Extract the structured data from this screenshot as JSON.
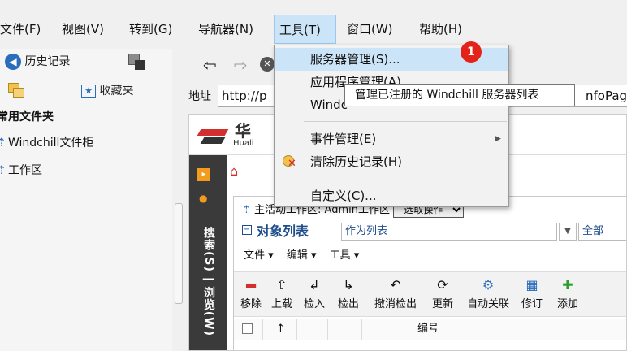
{
  "menubar": {
    "items": [
      "文件(F)",
      "视图(V)",
      "转到(G)",
      "导航器(N)",
      "工具(T)",
      "窗口(W)",
      "帮助(H)"
    ]
  },
  "left_pane": {
    "history_label": "历史记录",
    "favorites_label": "收藏夹",
    "tree_header": "常用文件夹",
    "tree_items": [
      "Windchill文件柜",
      "工作区"
    ]
  },
  "address": {
    "label": "地址",
    "value_start": "http://p",
    "value_end": "nfoPage?"
  },
  "banner": {
    "brand_cn": "华",
    "brand_en": "Huali"
  },
  "sidebar": {
    "vertical_text": "搜索(S) | 浏览(W)"
  },
  "workspace": {
    "label": "主活动工作区: Admin工作区",
    "select_value": "- 选取操作 -"
  },
  "object_list": {
    "title": "对象列表",
    "view": "作为列表",
    "filter": "全部",
    "action_menus": [
      "文件 ▾",
      "编辑 ▾",
      "工具 ▾"
    ],
    "toolbar": [
      "移除",
      "上载",
      "检入",
      "检出",
      "撤消检出",
      "更新",
      "自动关联",
      "修订",
      "添加"
    ],
    "column_number": "编号"
  },
  "tools_menu": {
    "items": [
      "服务器管理(S)...",
      "应用程序管理(A)...",
      "Windc",
      "事件管理(E)",
      "清除历史记录(H)",
      "自定义(C)..."
    ]
  },
  "tooltip": {
    "text": "管理已注册的 Windchill 服务器列表"
  },
  "badge": {
    "number": "1"
  }
}
